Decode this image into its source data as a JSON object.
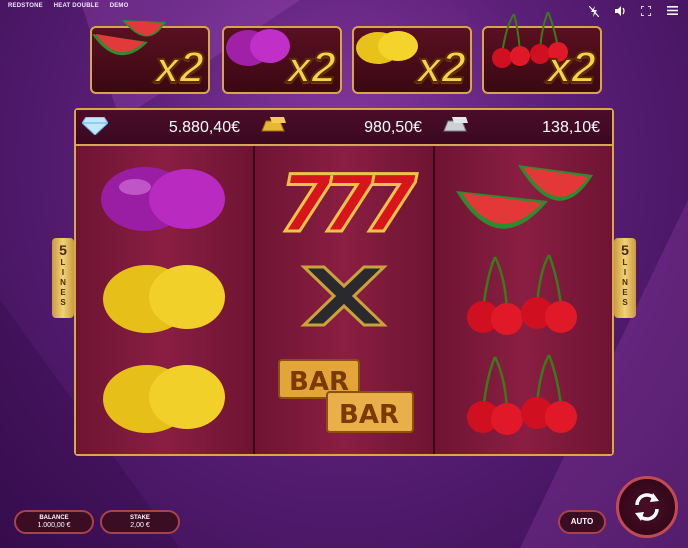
{
  "header": {
    "brand": "REDSTONE",
    "game": "HEAT DOUBLE",
    "mode": "DEMO",
    "icons": [
      "lightning-off-icon",
      "sound-icon",
      "fullscreen-icon",
      "menu-icon"
    ]
  },
  "multipliers": [
    {
      "symbol": "watermelon",
      "label": "x2"
    },
    {
      "symbol": "plum",
      "label": "x2"
    },
    {
      "symbol": "lemon",
      "label": "x2"
    },
    {
      "symbol": "cherry",
      "label": "x2"
    }
  ],
  "jackpots": [
    {
      "icon": "diamond-icon",
      "value": "5.880,40€"
    },
    {
      "icon": "gold-bar-icon",
      "value": "980,50€"
    },
    {
      "icon": "silver-bar-icon",
      "value": "138,10€"
    }
  ],
  "reels": [
    [
      "plum",
      "lemon",
      "lemon"
    ],
    [
      "seven",
      "x",
      "bar"
    ],
    [
      "watermelon",
      "cherry",
      "cherry"
    ]
  ],
  "lines": {
    "number": "5",
    "word": "L\nI\nN\nE\nS"
  },
  "footer": {
    "balance_label": "BALANCE",
    "balance_value": "1.000,00 €",
    "stake_label": "STAKE",
    "stake_value": "2,00 €",
    "auto_label": "AUTO"
  },
  "colors": {
    "gold": "#d9a84a",
    "accent": "#c24a52",
    "background": "#5b1f78"
  }
}
